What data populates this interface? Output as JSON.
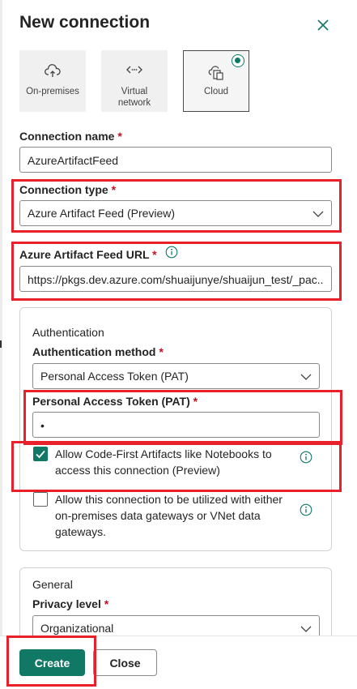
{
  "dialog": {
    "title": "New connection"
  },
  "tiles": [
    {
      "label": "On-premises",
      "icon": "cloud-upload-icon"
    },
    {
      "label": "Virtual network",
      "icon": "code-dots-icon"
    },
    {
      "label": "Cloud",
      "icon": "cloud-document-icon",
      "selected": true
    }
  ],
  "connection_name": {
    "label": "Connection name",
    "required": "*",
    "value": "AzureArtifactFeed"
  },
  "connection_type": {
    "label": "Connection type",
    "required": "*",
    "value": "Azure Artifact Feed (Preview)"
  },
  "feed_url": {
    "label": "Azure Artifact Feed URL",
    "required": "*",
    "value": "https://pkgs.dev.azure.com/shuaijunye/shuaijun_test/_pac..."
  },
  "authentication": {
    "heading": "Authentication",
    "method_label": "Authentication method",
    "method_required": "*",
    "method_value": "Personal Access Token (PAT)",
    "pat_label": "Personal Access Token (PAT)",
    "pat_required": "*",
    "pat_value": "•",
    "code_first": {
      "line1": "Allow Code-First Artifacts like Notebooks to",
      "line2": "access this connection (Preview)",
      "checked": true
    },
    "gateways": {
      "line1": "Allow this connection to be utilized with either",
      "line2": "on-premises data gateways or VNet data",
      "line3": "gateways.",
      "checked": false
    }
  },
  "general": {
    "heading": "General",
    "privacy_label": "Privacy level",
    "privacy_required": "*",
    "privacy_value": "Organizational"
  },
  "footer": {
    "create_label": "Create",
    "close_label": "Close"
  },
  "colors": {
    "accent": "#117865",
    "highlight": "#e8202a",
    "required": "#c50f1f"
  }
}
